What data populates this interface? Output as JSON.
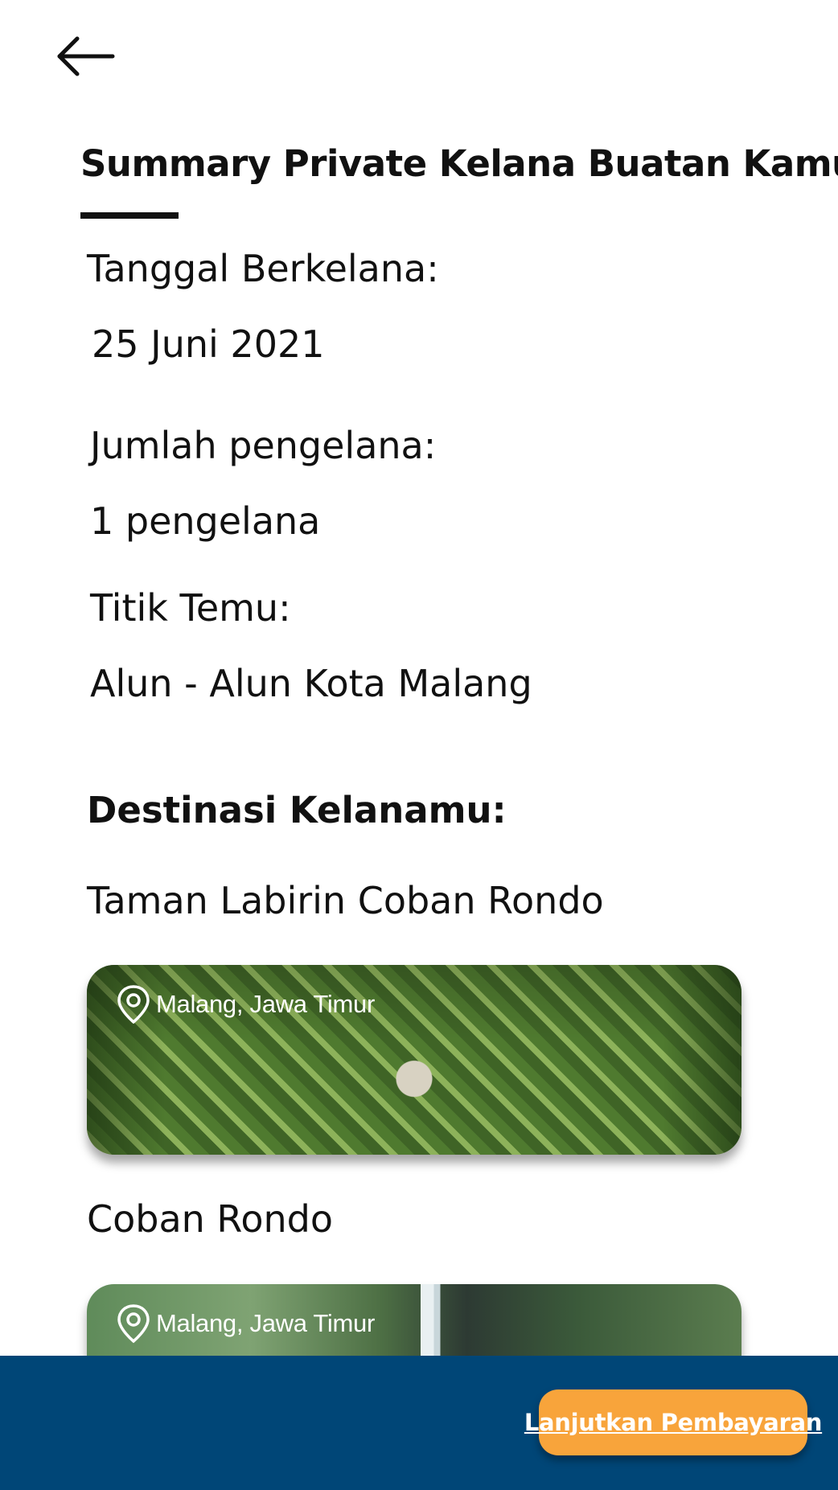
{
  "header": {
    "back_icon": "arrow-left-icon",
    "title": "Summary Private Kelana Buatan Kamu"
  },
  "summary": {
    "date_label": "Tanggal Berkelana:",
    "date_value": "25 Juni 2021",
    "travelers_label": "Jumlah pengelana:",
    "travelers_value": "1 pengelana",
    "meeting_point_label": "Titik Temu:",
    "meeting_point_value": "Alun - Alun Kota Malang"
  },
  "destinations": {
    "heading": "Destinasi Kelanamu:",
    "items": [
      {
        "name": "Taman Labirin Coban Rondo",
        "location": "Malang, Jawa Timur",
        "location_icon": "location-pin-icon"
      },
      {
        "name": "Coban Rondo",
        "location": "Malang, Jawa Timur",
        "location_icon": "location-pin-icon"
      }
    ]
  },
  "footer": {
    "pay_label": "Lanjutkan Pembayaran"
  },
  "colors": {
    "bottom_bar": "#004677",
    "pay_button": "#f8a43b",
    "text": "#111111"
  }
}
